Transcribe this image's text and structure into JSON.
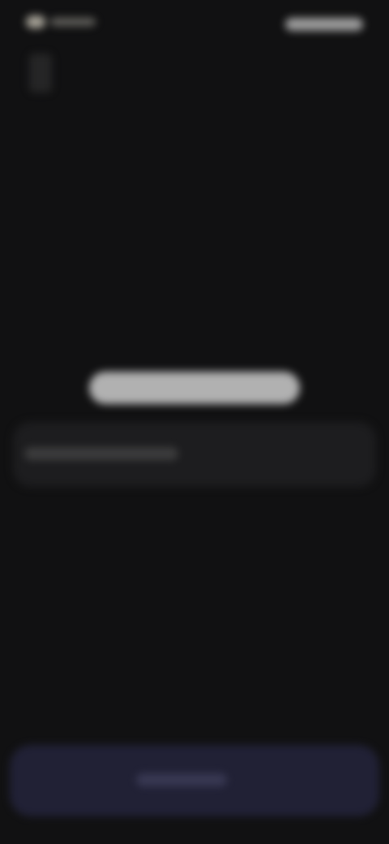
{
  "status_bar": {
    "left": "",
    "right": ""
  },
  "main": {
    "title": "",
    "input_placeholder": "",
    "input_value": ""
  },
  "footer": {
    "button_label": ""
  },
  "colors": {
    "background": "#111112",
    "input_bg": "#1d1d1f",
    "button_bg": "#24243c"
  }
}
